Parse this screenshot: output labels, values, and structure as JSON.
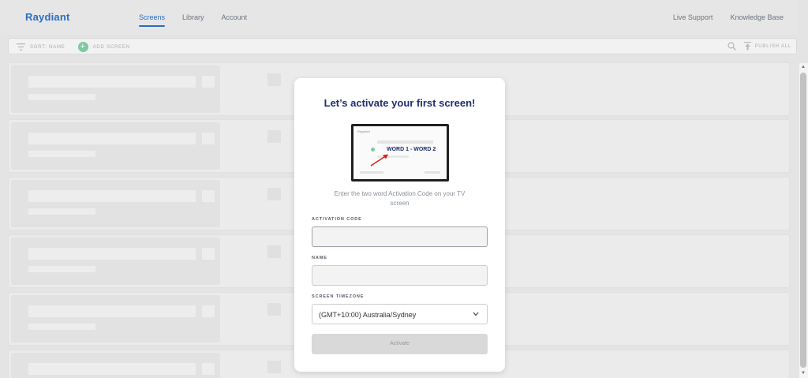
{
  "header": {
    "brand": "Raydiant",
    "nav": [
      "Screens",
      "Library",
      "Account"
    ],
    "right_links": [
      "Live Support",
      "Knowledge Base"
    ],
    "accent": "#2b6cc4"
  },
  "toolbar": {
    "sort_label": "SORT: NAME",
    "add_label": "ADD SCREEN",
    "publish_label": "PUBLISH ALL"
  },
  "modal": {
    "title": "Let’s activate your first screen!",
    "illustration": {
      "brand": "Raydiant",
      "code": "WORD 1 - WORD 2"
    },
    "description": "Enter the two word Activation Code on your TV screen",
    "activation_label": "ACTIVATION CODE",
    "activation_value": "",
    "name_label": "NAME",
    "name_value": "",
    "timezone_label": "SCREEN TIMEZONE",
    "timezone_value": "(GMT+10:00) Australia/Sydney",
    "activate_label": "Activate"
  }
}
